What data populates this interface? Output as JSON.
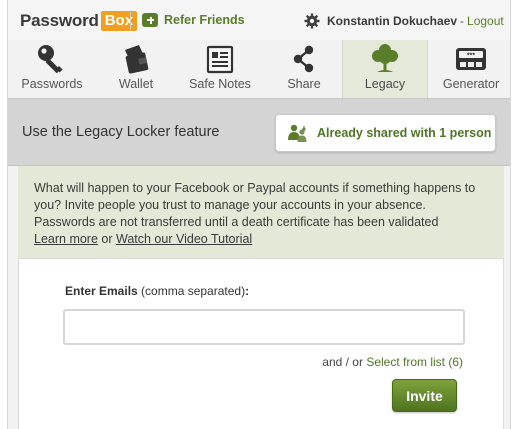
{
  "brand": {
    "logo_text": "Password",
    "logo_box": "Box"
  },
  "topbar": {
    "refer_label": "Refer Friends",
    "refer_icon": "plus-square-icon",
    "user_icon": "gear-icon",
    "username": "Konstantin Dokuchaev",
    "separator": "-",
    "logout_label": "Logout"
  },
  "nav": {
    "active_tab": "Legacy",
    "tabs": [
      {
        "label": "Passwords",
        "icon": "key-icon"
      },
      {
        "label": "Wallet",
        "icon": "wallet-icon"
      },
      {
        "label": "Safe Notes",
        "icon": "notes-icon"
      },
      {
        "label": "Share",
        "icon": "share-icon"
      },
      {
        "label": "Legacy",
        "icon": "tree-icon"
      },
      {
        "label": "Generator",
        "icon": "password-generator-icon"
      }
    ]
  },
  "header": {
    "title": "Use the Legacy Locker feature",
    "shared_button": "Already shared with 1 person",
    "shared_icon": "shared-users-icon"
  },
  "info": {
    "text": "What will happen to your Facebook or Paypal accounts if something happens to you? Invite people you trust to manage your accounts in your absence. Passwords are not transferred until a death certificate has been validated",
    "learn_more": "Learn more",
    "or": " or ",
    "video_link": "Watch our Video Tutorial"
  },
  "form": {
    "label_bold": "Enter Emails",
    "label_hint": " (comma separated)",
    "label_colon": ":",
    "email_value": "",
    "and_or": "and / or ",
    "select_link": "Select from list (6)",
    "invite_label": "Invite"
  },
  "colors": {
    "accent_green": "#5a7d2a",
    "logo_orange": "#f0a020",
    "info_bg": "#e3e9d6",
    "active_tab_bg": "#e5e9da"
  }
}
